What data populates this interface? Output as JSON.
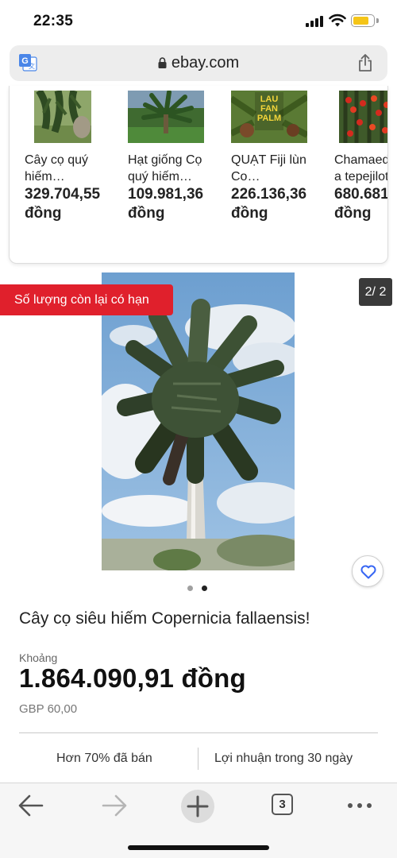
{
  "status_bar": {
    "time": "22:35"
  },
  "address_bar": {
    "url": "ebay.com"
  },
  "carousel": {
    "items": [
      {
        "title": "Cây cọ quý\nhiếm…",
        "price": "329.704,55\nđồng"
      },
      {
        "title": "Hạt giống Cọ\nquý hiếm…",
        "price": "109.981,36\nđồng"
      },
      {
        "title": "QUẠT Fiji lùn\nCo…",
        "price": "226.136,36\nđồng",
        "thumb_text": "LAU\nFAN\nPALM"
      },
      {
        "title": "Chamaed\na tepejilot",
        "price": "680.681\nđồng"
      }
    ]
  },
  "hero": {
    "limited_badge": "Số lượng còn lại có hạn",
    "page_counter": "2/ 2",
    "dots_total": 2,
    "dots_active_index": 1
  },
  "product": {
    "title": "Cây cọ siêu hiếm Copernicia fallaensis!",
    "price_label": "Khoảng",
    "price": "1.864.090,91 đồng",
    "price_original": "GBP 60,00",
    "stat_sold": "Hơn 70% đã bán",
    "stat_returns": "Lợi nhuận trong 30 ngày"
  },
  "toolbar": {
    "tab_count": "3"
  },
  "icons": {
    "translate": "translate-icon",
    "lock": "lock-icon",
    "share": "share-icon",
    "heart": "heart-icon",
    "back": "back-arrow-icon",
    "forward": "forward-arrow-icon",
    "new_tab": "plus-icon",
    "tabs": "tabs-icon",
    "more": "more-icon"
  },
  "colors": {
    "badge_red": "#e0202c",
    "heart_blue": "#3665f3",
    "battery_yellow": "#f5c518"
  }
}
